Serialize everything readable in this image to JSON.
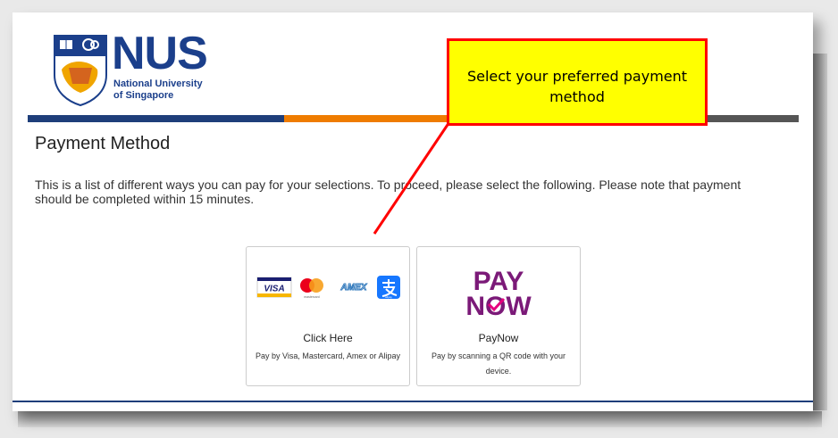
{
  "logo": {
    "wordmark": "NUS",
    "line1": "National University",
    "line2": "of Singapore"
  },
  "page": {
    "title": "Payment Method",
    "intro": "This is a list of different ways you can pay for your selections. To proceed, please select the following. Please note that payment should be completed within 15 minutes."
  },
  "cards": [
    {
      "name": "Click Here",
      "description": "Pay by Visa, Mastercard, Amex or Alipay",
      "logos": [
        "VISA",
        "mastercard",
        "AMEX",
        "alipay"
      ]
    },
    {
      "name": "PayNow",
      "description": "Pay by scanning a QR code with your device.",
      "logo_line1": "PAY",
      "logo_line2": "NOW"
    }
  ],
  "callout": {
    "text": "Select your preferred payment method"
  },
  "colors": {
    "brand_blue": "#1e3e7a",
    "brand_orange": "#ef7c00",
    "paynow_purple": "#7b1a78",
    "callout_fill": "#ffff00",
    "callout_border": "#ff0000"
  }
}
